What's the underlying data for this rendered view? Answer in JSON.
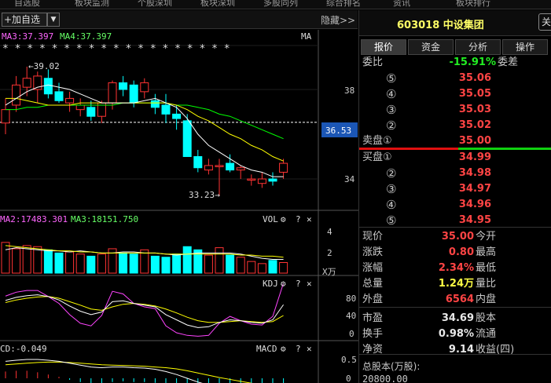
{
  "topbar": {
    "items": [
      "自选股",
      "板块监测",
      "个股深圳",
      "板块深圳",
      "多股同列",
      "综合排名",
      "资讯",
      "板块排行"
    ]
  },
  "toolbar": {
    "add_label": "+加自选",
    "dropdown_glyph": "▼",
    "hide_label": "隐藏>>"
  },
  "main_chart": {
    "ma3_label": "MA3:37.397",
    "ma4_label": "MA4:37.397",
    "ma_tag": "MA",
    "stars": "* *  * *  * * * * * * *       *    * * * * * * *",
    "high_annotation": "←39.02",
    "low_annotation": "33.23→",
    "price_ticks": [
      "38",
      "36",
      "34"
    ],
    "current_price_tag": "36.53",
    "colors": {
      "up": "#ff3333",
      "down": "#00ffff",
      "ma5": "#ffffff",
      "ma10": "#ffff00",
      "ma20": "#00ff00"
    }
  },
  "vol_panel": {
    "ma2_label": "MA2:17483.301",
    "ma3_label": "MA3:18151.750",
    "name": "VOL",
    "ticks": [
      "4",
      "2"
    ],
    "unit": "X万"
  },
  "kdj_panel": {
    "name": "KDJ",
    "ticks": [
      "80",
      "40",
      "0"
    ]
  },
  "macd_panel": {
    "name": "MACD",
    "label": "CD:-0.049",
    "ticks": [
      "0.5",
      "0"
    ]
  },
  "panel_icons": {
    "gear": "⚙",
    "help": "?",
    "close": "✕"
  },
  "chart_data": [
    {
      "type": "candlestick",
      "title": "",
      "ylim": [
        32.8,
        40.0
      ],
      "candles": [
        {
          "o": 36.5,
          "h": 37.6,
          "l": 36.0,
          "c": 37.1
        },
        {
          "o": 37.3,
          "h": 38.6,
          "l": 37.0,
          "c": 38.2
        },
        {
          "o": 38.1,
          "h": 39.02,
          "l": 37.7,
          "c": 38.5
        },
        {
          "o": 38.0,
          "h": 38.8,
          "l": 37.4,
          "c": 38.6
        },
        {
          "o": 38.5,
          "h": 38.9,
          "l": 37.6,
          "c": 37.8
        },
        {
          "o": 37.9,
          "h": 38.3,
          "l": 37.4,
          "c": 37.5
        },
        {
          "o": 37.4,
          "h": 37.9,
          "l": 37.0,
          "c": 37.6
        },
        {
          "o": 37.1,
          "h": 37.6,
          "l": 36.8,
          "c": 37.3
        },
        {
          "o": 37.2,
          "h": 37.5,
          "l": 36.6,
          "c": 36.8
        },
        {
          "o": 36.8,
          "h": 37.5,
          "l": 36.5,
          "c": 37.4
        },
        {
          "o": 37.4,
          "h": 38.4,
          "l": 37.1,
          "c": 38.3
        },
        {
          "o": 38.3,
          "h": 38.6,
          "l": 37.7,
          "c": 38.0
        },
        {
          "o": 38.2,
          "h": 38.4,
          "l": 37.2,
          "c": 37.4
        },
        {
          "o": 37.9,
          "h": 38.5,
          "l": 37.6,
          "c": 38.3
        },
        {
          "o": 37.5,
          "h": 37.8,
          "l": 36.9,
          "c": 37.2
        },
        {
          "o": 37.3,
          "h": 37.8,
          "l": 36.5,
          "c": 36.9
        },
        {
          "o": 36.9,
          "h": 37.3,
          "l": 36.2,
          "c": 36.7
        },
        {
          "o": 36.6,
          "h": 36.9,
          "l": 35.0,
          "c": 35.0
        },
        {
          "o": 35.0,
          "h": 35.3,
          "l": 34.3,
          "c": 34.5
        },
        {
          "o": 34.4,
          "h": 34.9,
          "l": 34.2,
          "c": 34.6
        },
        {
          "o": 34.6,
          "h": 34.9,
          "l": 33.23,
          "c": 34.6
        },
        {
          "o": 34.7,
          "h": 35.1,
          "l": 34.3,
          "c": 34.4
        },
        {
          "o": 34.4,
          "h": 34.6,
          "l": 34.0,
          "c": 34.5
        },
        {
          "o": 34.0,
          "h": 34.2,
          "l": 33.7,
          "c": 34.0
        },
        {
          "o": 33.8,
          "h": 34.3,
          "l": 33.6,
          "c": 34.0
        },
        {
          "o": 34.0,
          "h": 34.3,
          "l": 33.7,
          "c": 33.9
        },
        {
          "o": 34.3,
          "h": 34.9,
          "l": 34.0,
          "c": 34.7
        }
      ],
      "ma5": [
        37.3,
        37.6,
        37.9,
        38.1,
        38.2,
        38.1,
        38.0,
        37.8,
        37.6,
        37.4,
        37.4,
        37.4,
        37.4,
        37.5,
        37.6,
        37.4,
        37.2,
        36.7,
        36.0,
        35.5,
        35.2,
        34.9,
        34.6,
        34.4,
        34.3,
        34.1,
        34.1
      ],
      "ma10": [
        37.6,
        37.6,
        37.5,
        37.4,
        37.3,
        37.3,
        37.3,
        37.4,
        37.4,
        37.4,
        37.4,
        37.4,
        37.4,
        37.4,
        37.4,
        37.4,
        37.3,
        37.1,
        36.8,
        36.6,
        36.3,
        36.0,
        35.8,
        35.5,
        35.3,
        35.0,
        34.8
      ],
      "ma20": [
        37.1,
        37.1,
        37.2,
        37.2,
        37.3,
        37.3,
        37.3,
        37.3,
        37.3,
        37.3,
        37.3,
        37.4,
        37.4,
        37.4,
        37.4,
        37.4,
        37.3,
        37.3,
        37.2,
        37.1,
        36.9,
        36.8,
        36.6,
        36.4,
        36.2,
        36.0,
        35.8
      ]
    },
    {
      "type": "bar",
      "title": "",
      "ylim": [
        0,
        5
      ],
      "values": [
        2.9,
        2.3,
        2.6,
        2.5,
        2.2,
        1.9,
        2.0,
        1.8,
        1.6,
        1.8,
        2.3,
        1.9,
        1.8,
        2.2,
        1.6,
        1.5,
        1.8,
        2.5,
        2.2,
        1.7,
        2.4,
        1.7,
        1.5,
        1.1,
        0.9,
        1.2,
        1.0
      ],
      "ma1": [
        2.2,
        2.4,
        2.3,
        2.2,
        2.1,
        2.1,
        2.0,
        2.1,
        2.0,
        1.9,
        1.9,
        2.0,
        2.0,
        1.9,
        1.9,
        1.8,
        1.7,
        1.8,
        1.9,
        1.9,
        1.9,
        1.9,
        1.8,
        1.6,
        1.4,
        1.3,
        1.3
      ],
      "ma2": [
        2.6,
        2.5,
        2.4,
        2.3,
        2.2,
        2.1,
        2.1,
        2.0,
        2.0,
        1.9,
        1.9,
        1.9,
        1.9,
        1.9,
        1.9,
        1.8,
        1.8,
        1.8,
        1.8,
        1.8,
        1.8,
        1.8,
        1.7,
        1.7,
        1.6,
        1.6,
        1.5
      ]
    },
    {
      "type": "line",
      "title": "",
      "ylim": [
        -10,
        100
      ],
      "k": [
        75,
        82,
        86,
        88,
        84,
        76,
        62,
        50,
        42,
        48,
        72,
        74,
        68,
        64,
        60,
        42,
        30,
        18,
        12,
        14,
        24,
        30,
        28,
        24,
        22,
        30,
        65
      ],
      "d": [
        70,
        76,
        80,
        83,
        84,
        80,
        72,
        64,
        55,
        52,
        60,
        66,
        68,
        66,
        62,
        55,
        46,
        36,
        28,
        24,
        24,
        26,
        28,
        26,
        24,
        26,
        40
      ],
      "j": [
        85,
        94,
        98,
        98,
        84,
        68,
        42,
        22,
        16,
        40,
        96,
        90,
        68,
        60,
        56,
        16,
        0,
        -6,
        -8,
        -6,
        22,
        38,
        28,
        20,
        18,
        38,
        115
      ]
    },
    {
      "type": "line",
      "title": "",
      "ylim": [
        -0.4,
        0.7
      ],
      "dif": [
        0.45,
        0.48,
        0.5,
        0.5,
        0.48,
        0.45,
        0.4,
        0.35,
        0.3,
        0.28,
        0.3,
        0.3,
        0.28,
        0.27,
        0.24,
        0.18,
        0.1,
        0.0,
        -0.1,
        -0.18,
        -0.22,
        -0.26,
        -0.3,
        -0.32,
        -0.33,
        -0.34,
        -0.3
      ],
      "dea": [
        0.36,
        0.38,
        0.4,
        0.42,
        0.43,
        0.43,
        0.42,
        0.4,
        0.38,
        0.36,
        0.35,
        0.34,
        0.33,
        0.32,
        0.3,
        0.28,
        0.25,
        0.2,
        0.14,
        0.08,
        0.02,
        -0.03,
        -0.08,
        -0.13,
        -0.17,
        -0.2,
        -0.22
      ],
      "macd": [
        0.18,
        0.2,
        0.2,
        0.16,
        0.1,
        0.04,
        -0.04,
        -0.1,
        -0.16,
        -0.16,
        -0.1,
        -0.08,
        -0.1,
        -0.1,
        -0.12,
        -0.2,
        -0.3,
        -0.4,
        -0.48,
        -0.52,
        -0.48,
        -0.46,
        -0.44,
        -0.38,
        -0.32,
        -0.28,
        -0.16
      ]
    }
  ],
  "quote_panel": {
    "stock_title": "603018 中设集团",
    "self_button": "关",
    "tabs": [
      "报价",
      "资金",
      "分析",
      "操作"
    ],
    "wb_label": "委比",
    "wb_value": "-15.91%",
    "wc_label": "委差",
    "sell_label": "卖盘①",
    "buy_label": "买盘①",
    "sell_levels": [
      {
        "label": "⑤",
        "price": "35.06"
      },
      {
        "label": "④",
        "price": "35.05"
      },
      {
        "label": "③",
        "price": "35.03"
      },
      {
        "label": "②",
        "price": "35.02"
      },
      {
        "label": "",
        "price": "35.00"
      }
    ],
    "buy_levels": [
      {
        "label": "",
        "price": "34.99"
      },
      {
        "label": "②",
        "price": "34.98"
      },
      {
        "label": "③",
        "price": "34.97"
      },
      {
        "label": "④",
        "price": "34.96"
      },
      {
        "label": "⑤",
        "price": "34.95"
      }
    ],
    "stats": [
      {
        "l1": "现价",
        "v1": "35.00",
        "l2": "今开",
        "c": "red"
      },
      {
        "l1": "涨跌",
        "v1": "0.80",
        "l2": "最高",
        "c": "red"
      },
      {
        "l1": "涨幅",
        "v1": "2.34%",
        "l2": "最低",
        "c": "red"
      },
      {
        "l1": "总量",
        "v1": "1.24万",
        "l2": "量比",
        "c": "yellow"
      },
      {
        "l1": "外盘",
        "v1": "6564",
        "l2": "内盘",
        "c": "red"
      },
      {
        "l1": "市盈",
        "v1": "34.69",
        "l2": "股本",
        "c": "white"
      },
      {
        "l1": "换手",
        "v1": "0.98%",
        "l2": "流通",
        "c": "white"
      },
      {
        "l1": "净资",
        "v1": "9.14",
        "l2": "收益(四)",
        "c": "white"
      }
    ],
    "total_share_label": "总股本(万股):",
    "total_share_value": "20800.00"
  }
}
